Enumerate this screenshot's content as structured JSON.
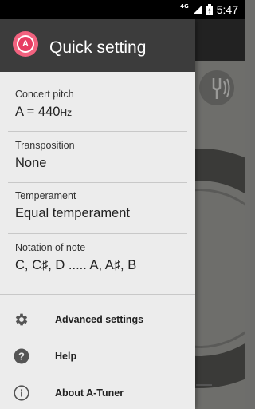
{
  "status_bar": {
    "network": "4G",
    "time": "5:47"
  },
  "drawer": {
    "title": "Quick setting",
    "icon_letter": "A",
    "settings": [
      {
        "label": "Concert pitch",
        "value": "A = 440",
        "unit": "Hz"
      },
      {
        "label": "Transposition",
        "value": "None"
      },
      {
        "label": "Temperament",
        "value": "Equal temperament"
      },
      {
        "label": "Notation of note",
        "value": "C, C♯, D ..... A, A♯, B"
      }
    ],
    "menu": [
      {
        "label": "Advanced settings",
        "icon": "gear-icon"
      },
      {
        "label": "Help",
        "icon": "help-icon"
      },
      {
        "label": "About A-Tuner",
        "icon": "info-icon"
      }
    ]
  },
  "colors": {
    "accent": "#e73d63",
    "header": "#3c3c3c",
    "drawer_bg": "#ececec"
  }
}
